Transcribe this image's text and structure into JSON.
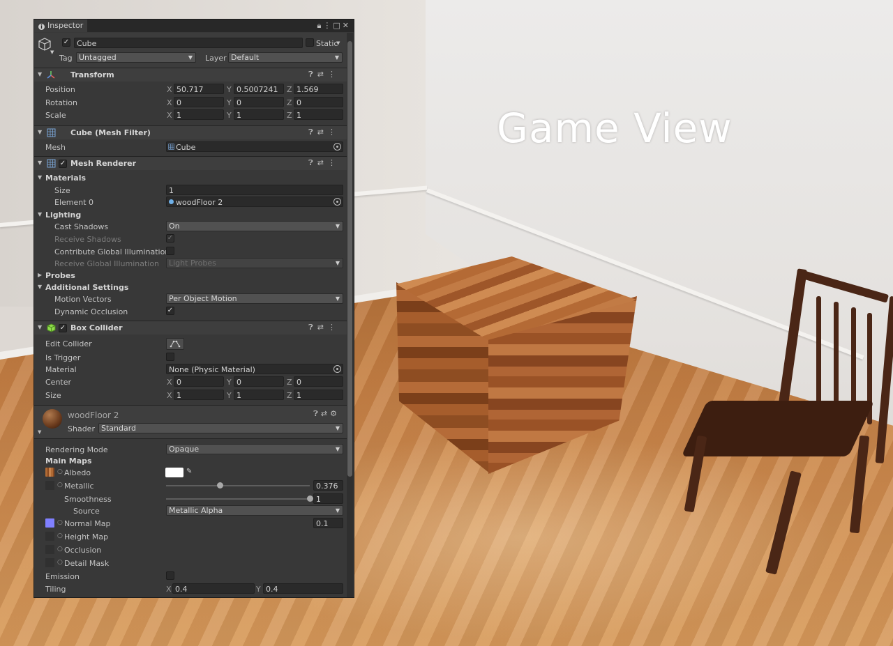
{
  "game_view": {
    "title": "Game View"
  },
  "inspector": {
    "tab_label": "Inspector",
    "object": {
      "name": "Cube",
      "static_label": "Static",
      "tag_label": "Tag",
      "tag_value": "Untagged",
      "layer_label": "Layer",
      "layer_value": "Default"
    },
    "transform": {
      "title": "Transform",
      "position": {
        "label": "Position",
        "x": "50.717",
        "y": "0.5007241",
        "z": "1.569"
      },
      "rotation": {
        "label": "Rotation",
        "x": "0",
        "y": "0",
        "z": "0"
      },
      "scale": {
        "label": "Scale",
        "x": "1",
        "y": "1",
        "z": "1"
      }
    },
    "mesh_filter": {
      "title": "Cube (Mesh Filter)",
      "mesh_label": "Mesh",
      "mesh_value": "Cube"
    },
    "mesh_renderer": {
      "title": "Mesh Renderer",
      "materials_label": "Materials",
      "size_label": "Size",
      "size_value": "1",
      "element0_label": "Element 0",
      "element0_value": "woodFloor 2",
      "lighting_label": "Lighting",
      "cast_shadows_label": "Cast Shadows",
      "cast_shadows_value": "On",
      "receive_shadows_label": "Receive Shadows",
      "contribute_gi_label": "Contribute Global Illumination",
      "receive_gi_label": "Receive Global Illumination",
      "receive_gi_value": "Light Probes",
      "probes_label": "Probes",
      "additional_label": "Additional Settings",
      "motion_vectors_label": "Motion Vectors",
      "motion_vectors_value": "Per Object Motion",
      "dynamic_occlusion_label": "Dynamic Occlusion"
    },
    "box_collider": {
      "title": "Box Collider",
      "edit_collider_label": "Edit Collider",
      "is_trigger_label": "Is Trigger",
      "material_label": "Material",
      "material_value": "None (Physic Material)",
      "center": {
        "label": "Center",
        "x": "0",
        "y": "0",
        "z": "0"
      },
      "size": {
        "label": "Size",
        "x": "1",
        "y": "1",
        "z": "1"
      }
    },
    "material": {
      "name": "woodFloor 2",
      "shader_label": "Shader",
      "shader_value": "Standard",
      "rendering_mode_label": "Rendering Mode",
      "rendering_mode_value": "Opaque",
      "main_maps_label": "Main Maps",
      "albedo_label": "Albedo",
      "metallic_label": "Metallic",
      "metallic_value": "0.376",
      "metallic_fraction": 0.376,
      "smoothness_label": "Smoothness",
      "smoothness_value": "1",
      "smoothness_fraction": 1.0,
      "source_label": "Source",
      "source_value": "Metallic Alpha",
      "normal_map_label": "Normal Map",
      "normal_map_value": "0.1",
      "height_map_label": "Height Map",
      "occlusion_label": "Occlusion",
      "detail_mask_label": "Detail Mask",
      "emission_label": "Emission",
      "tiling_label": "Tiling",
      "tiling_x": "0.4",
      "tiling_y": "0.4"
    },
    "axis": {
      "x": "X",
      "y": "Y",
      "z": "Z"
    }
  },
  "colors": {
    "panel_bg": "#383838",
    "header_bg": "#3e3e3e",
    "field_bg": "#2a2a2a",
    "text": "#c4c4c4",
    "normal_map_swatch": "#8080ff",
    "albedo_swatch": "#ffffff"
  }
}
